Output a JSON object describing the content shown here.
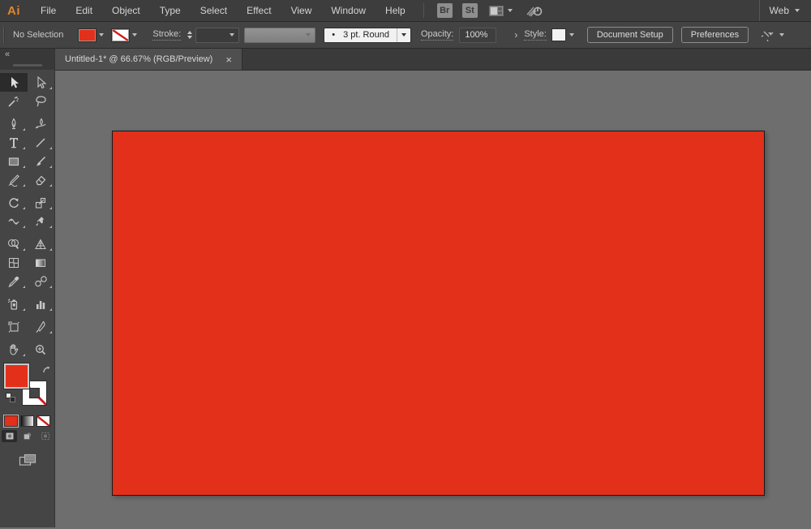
{
  "menubar": {
    "logo": "Ai",
    "items": [
      {
        "label": "File"
      },
      {
        "label": "Edit"
      },
      {
        "label": "Object"
      },
      {
        "label": "Type"
      },
      {
        "label": "Select"
      },
      {
        "label": "Effect"
      },
      {
        "label": "View"
      },
      {
        "label": "Window"
      },
      {
        "label": "Help"
      }
    ],
    "apps": [
      {
        "label": "Br"
      },
      {
        "label": "St"
      }
    ],
    "workspace": "Web"
  },
  "controlbar": {
    "no_selection": "No Selection",
    "stroke_label": "Stroke:",
    "brush_bullet": "•",
    "brush_value": "3 pt. Round",
    "opacity_label": "Opacity:",
    "opacity_value": "100%",
    "opacity_arrow": "›",
    "style_label": "Style:",
    "document_setup_label": "Document Setup",
    "preferences_label": "Preferences"
  },
  "tabstrip": {
    "tabs": [
      {
        "title": "Untitled-1* @ 66.67% (RGB/Preview)",
        "close": "×"
      }
    ]
  },
  "toolbar": {
    "collapse": "«",
    "tools": [
      {
        "name": "selection-tool",
        "selected": true
      },
      {
        "name": "direct-selection-tool"
      },
      {
        "name": "magic-wand-tool"
      },
      {
        "name": "lasso-tool"
      },
      {
        "name": "pen-tool"
      },
      {
        "name": "curvature-tool"
      },
      {
        "name": "type-tool"
      },
      {
        "name": "line-segment-tool"
      },
      {
        "name": "rectangle-tool"
      },
      {
        "name": "paintbrush-tool"
      },
      {
        "name": "shaper-tool"
      },
      {
        "name": "eraser-tool"
      },
      {
        "name": "rotate-tool"
      },
      {
        "name": "scale-tool"
      },
      {
        "name": "width-tool"
      },
      {
        "name": "puppet-warp-tool"
      },
      {
        "name": "shape-builder-tool"
      },
      {
        "name": "perspective-grid-tool"
      },
      {
        "name": "mesh-tool"
      },
      {
        "name": "gradient-tool"
      },
      {
        "name": "eyedropper-tool"
      },
      {
        "name": "blend-tool"
      },
      {
        "name": "symbol-sprayer-tool"
      },
      {
        "name": "column-graph-tool"
      },
      {
        "name": "artboard-tool"
      },
      {
        "name": "slice-tool"
      },
      {
        "name": "hand-tool"
      },
      {
        "name": "zoom-tool"
      }
    ]
  },
  "colors": {
    "artboard_fill": "#e2301b",
    "canvas_background": "#6e6e6e",
    "panel_background": "#454545",
    "accent_logo": "#e0862c"
  }
}
